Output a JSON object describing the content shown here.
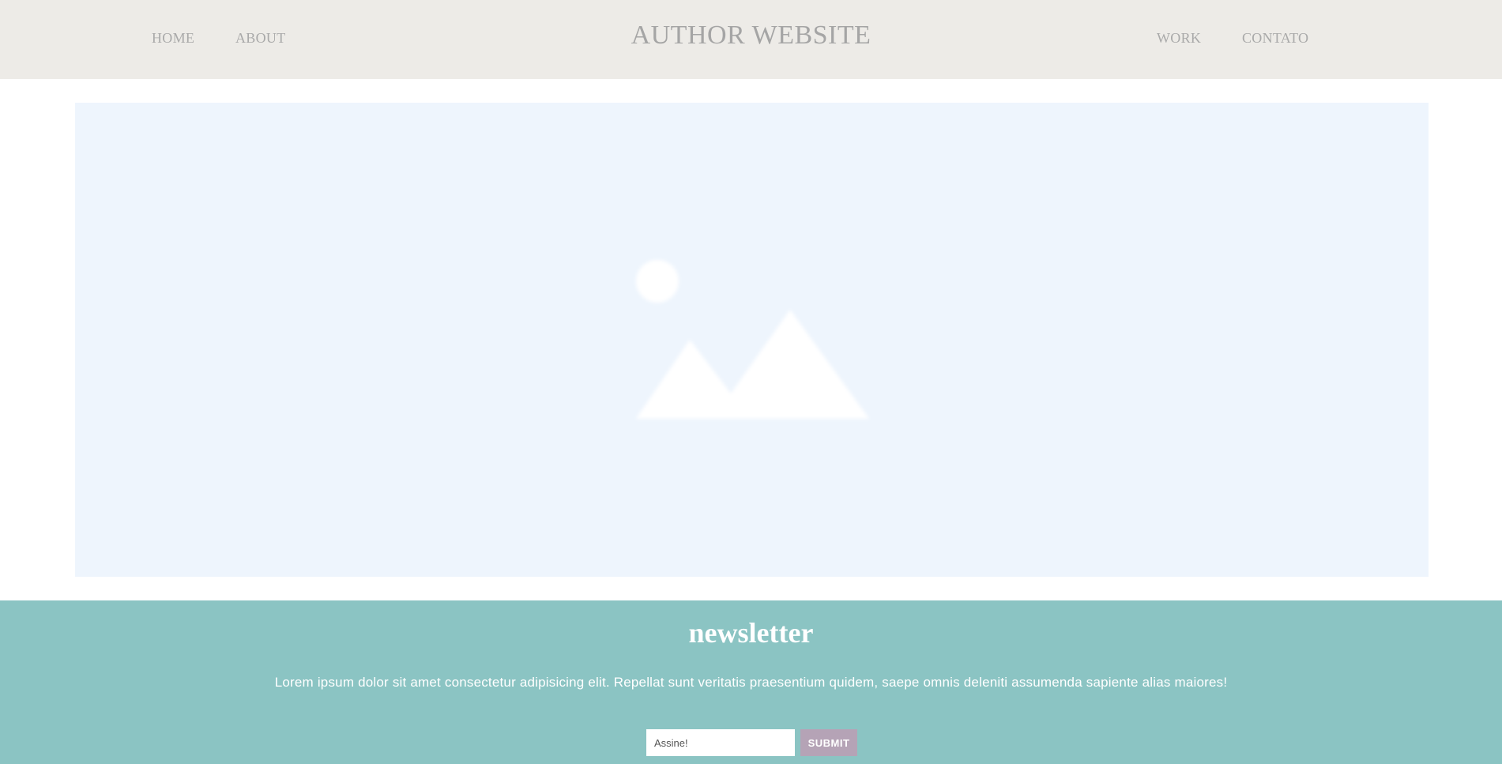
{
  "header": {
    "brand": "AUTHOR WEBSITE",
    "nav_left": [
      "HOME",
      "ABOUT"
    ],
    "nav_right": [
      "WORK",
      "CONTATO"
    ]
  },
  "hero": {
    "icon": "image-placeholder-icon"
  },
  "newsletter": {
    "title": "newsletter",
    "text": "Lorem ipsum dolor sit amet consectetur adipisicing elit. Repellat sunt veritatis praesentium quidem, saepe omnis deleniti assumenda sapiente alias maiores!",
    "input_value": "Assine!",
    "submit_label": "SUBMIT"
  },
  "colors": {
    "header_bg": "#edebe7",
    "hero_bg": "#eef5fd",
    "newsletter_bg": "#8bc4c3",
    "submit_bg": "#b5a3b6"
  }
}
